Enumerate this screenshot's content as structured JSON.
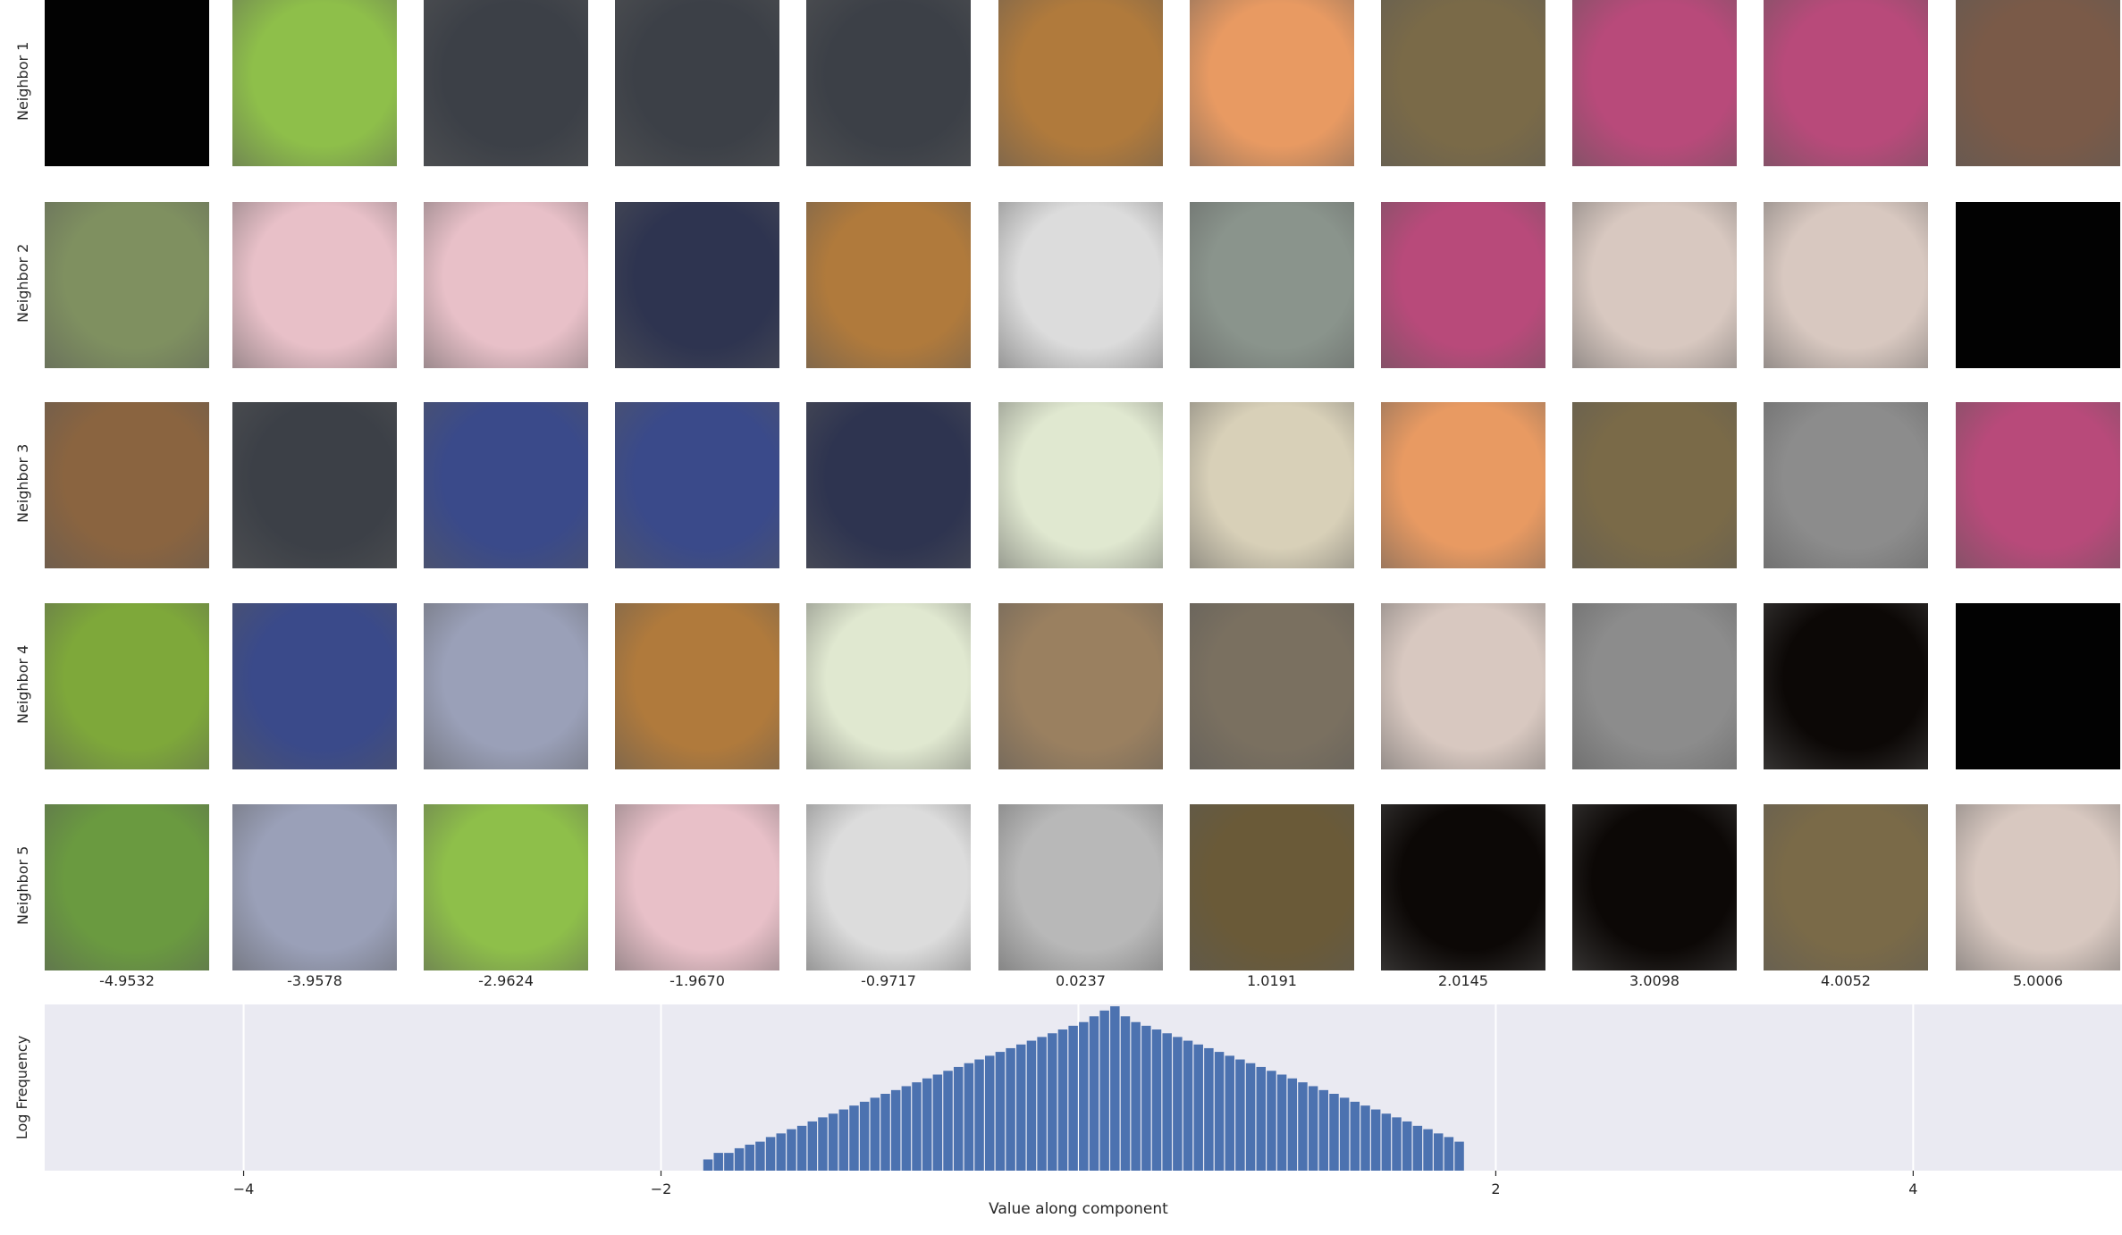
{
  "chart_data": {
    "type": "bar",
    "grid": {
      "row_labels": [
        "Neighbor 1",
        "Neighbor 2",
        "Neighbor 3",
        "Neighbor 4",
        "Neighbor 5"
      ],
      "column_values": [
        "-4.9532",
        "-3.9578",
        "-2.9624",
        "-1.9670",
        "-0.9717",
        "0.0237",
        "1.0191",
        "2.0145",
        "3.0098",
        "4.0052",
        "5.0006"
      ],
      "images": [
        [
          "black",
          "grasshopper",
          "iron",
          "iron",
          "iron",
          "foxes",
          "compass-box",
          "candy-sign",
          "perfume-box",
          "perfume-box",
          "harmonica-man"
        ],
        [
          "insect-on-twig",
          "pacifier",
          "pacifier",
          "dragonfly",
          "foxes",
          "man-dog-stroller",
          "pelican",
          "perfume-box",
          "ambulance",
          "ambulance",
          "black"
        ],
        [
          "yorkshire-terrier",
          "iron",
          "gym-bench",
          "gym-bench",
          "dragonfly",
          "leafhopper",
          "window",
          "compass-box",
          "candy-sign",
          "church-tower",
          "perfume-box"
        ],
        [
          "butterfly",
          "gym-bench",
          "butterfly-flower",
          "foxes",
          "leafhopper",
          "field",
          "crowd",
          "ambulance",
          "church-tower",
          "dark-lights",
          "black"
        ],
        [
          "puppy-in-grass",
          "butterfly-flower",
          "grasshopper",
          "pacifier",
          "man-dog-stroller",
          "weightlifter",
          "grass-bird",
          "dark-lights",
          "dark-lights",
          "candy-sign",
          "ambulance"
        ]
      ],
      "image_colors": {
        "black": "#020202",
        "grasshopper": "#8ebf4a",
        "iron": "#3c4047",
        "foxes": "#b07a3c",
        "compass-box": "#e89a62",
        "candy-sign": "#7a6a48",
        "perfume-box": "#b84a7a",
        "harmonica-man": "#7a5a48",
        "insect-on-twig": "#7f9060",
        "pacifier": "#e8c0c8",
        "dragonfly": "#2e3450",
        "man-dog-stroller": "#dcdcdc",
        "pelican": "#8a948c",
        "ambulance": "#d8c8c0",
        "yorkshire-terrier": "#8a6440",
        "gym-bench": "#3a4a8a",
        "leafhopper": "#e0e8d0",
        "window": "#d8d0b8",
        "church-tower": "#8c8c8c",
        "butterfly": "#7ea83a",
        "butterfly-flower": "#9aa0b8",
        "field": "#9a8060",
        "crowd": "#7a7060",
        "dark-lights": "#0c0806",
        "puppy-in-grass": "#6a9a40",
        "weightlifter": "#b8b8b8",
        "grass-bird": "#6a5a38"
      }
    },
    "histogram": {
      "x_label": "Value along component",
      "y_label": "Log Frequency",
      "x_ticks": [
        -4,
        -2,
        2,
        4
      ],
      "x_tick_labels": [
        "−4",
        "−2",
        "2",
        "4"
      ],
      "x_range": [
        -4.9532,
        5.0006
      ],
      "bar_color": "#4c72b0",
      "background": "#eaeaf2",
      "log_y": true,
      "bins_start": -1.8,
      "bin_width": 0.05,
      "frequencies": [
        1,
        2,
        2,
        3,
        4,
        5,
        7,
        9,
        12,
        15,
        20,
        26,
        33,
        43,
        55,
        70,
        90,
        115,
        145,
        185,
        235,
        300,
        380,
        480,
        610,
        770,
        970,
        1220,
        1550,
        1950,
        2450,
        3100,
        3900,
        4900,
        6200,
        7800,
        9800,
        14000,
        20000,
        26000,
        14000,
        9800,
        7800,
        6200,
        4900,
        3900,
        3100,
        2450,
        1950,
        1550,
        1220,
        970,
        770,
        610,
        480,
        380,
        300,
        235,
        185,
        145,
        115,
        90,
        70,
        55,
        43,
        33,
        26,
        20,
        15,
        12,
        9,
        7,
        5
      ]
    }
  }
}
